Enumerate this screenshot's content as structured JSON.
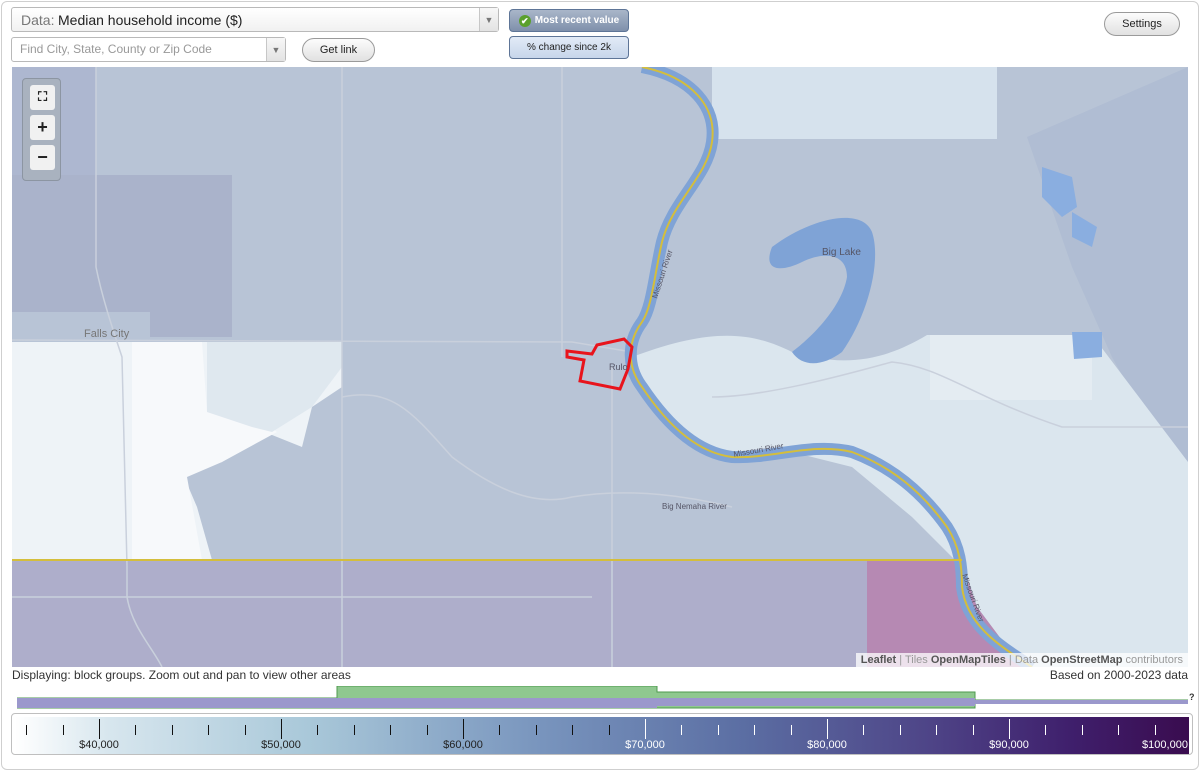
{
  "controls": {
    "data_select_prefix": "Data:",
    "data_select_value": "Median household income ($)",
    "search_placeholder": "Find City, State, County or Zip Code",
    "get_link_label": "Get link",
    "toggle_recent_label": "Most recent value",
    "toggle_change_label": "% change since 2k",
    "settings_label": "Settings"
  },
  "map": {
    "labels": {
      "falls_city": "Falls City",
      "big_lake": "Big Lake",
      "rulo": "Rulo",
      "missouri_river_1": "Missouri River",
      "missouri_river_2": "Missouri River",
      "missouri_river_3": "Missouri River",
      "big_nemaha": "Big Nemaha River"
    },
    "zoom": {
      "fullscreen": "fullscreen-icon",
      "zoom_in": "+",
      "zoom_out": "−"
    },
    "attribution": {
      "leaflet": "Leaflet",
      "sep1": "|",
      "tiles_prefix": "Tiles",
      "tiles": "OpenMapTiles",
      "sep2": "|",
      "data_prefix": "Data",
      "osm": "OpenStreetMap",
      "contributors": "contributors"
    },
    "colors": {
      "river": "#7fa3d6",
      "state_boundary": "#d4be3c",
      "highlight": "#e8141c"
    }
  },
  "footer": {
    "displaying": "Displaying: block groups. Zoom out and pan to view other areas",
    "based_on": "Based on 2000-2023 data"
  },
  "legend": {
    "tick_labels": [
      "$40,000",
      "$50,000",
      "$60,000",
      "$70,000",
      "$80,000",
      "$90,000",
      "$100,000"
    ],
    "colors": [
      "#ffffff",
      "#a9c8d9",
      "#5b6ea3",
      "#3a0c4f"
    ],
    "help_icon": "?"
  }
}
